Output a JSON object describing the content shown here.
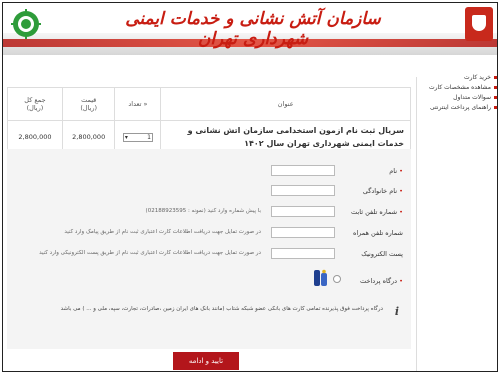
{
  "header": {
    "title": "سازمان آتش نشانی و خدمات ایمنی شهرداری تهران"
  },
  "sidebar": {
    "items": [
      {
        "label": "خرید کارت"
      },
      {
        "label": "مشاهده مشخصات کارت"
      },
      {
        "label": "سوالات متداول"
      },
      {
        "label": "راهنمای پرداخت اینترنتی"
      }
    ]
  },
  "cart": {
    "headers": {
      "title": "عنوان",
      "qty": "« تعداد",
      "price": "قیمت\n(ریال)",
      "total": "جمع کل\n(ریال)"
    },
    "row": {
      "title": "سریال ثبت نام ازمون استخدامی سازمان اتش نشانی و خدمات ایمنی شهرداری تهران سال ۱۴۰۲",
      "qty": "1",
      "price": "2,800,000",
      "total": "2,800,000"
    }
  },
  "form": {
    "name_label": "نام",
    "family_label": "نام خانوادگی",
    "phone_label": "شماره تلفن ثابت",
    "phone_hint": "با پیش شماره وارد کنید (نمونه : 02188923595)",
    "mobile_label": "شماره تلفن همراه",
    "mobile_hint": "در صورت تمایل جهت دریافت اطلاعات کارت اعتباری ثبت نام از طریق پیامک وارد کنید",
    "email_label": "پست الکترونیک",
    "email_hint": "در صورت تمایل جهت دریافت اطلاعات کارت اعتباری ثبت نام از طریق پست الکترونیکی وارد کنید",
    "gateway_label": "درگاه پرداخت",
    "info_text": "درگاه پرداخت فوق پذیرنده تمامی کارت های بانکی عضو شبکه شتاب (مانند بانک های ایران زمین ،صادرات، تجارت، سپه، ملی و ... ) می باشد",
    "submit_label": "تایید و ادامه"
  },
  "colors": {
    "brand_red": "#c81d12",
    "button_red": "#b3161b"
  }
}
